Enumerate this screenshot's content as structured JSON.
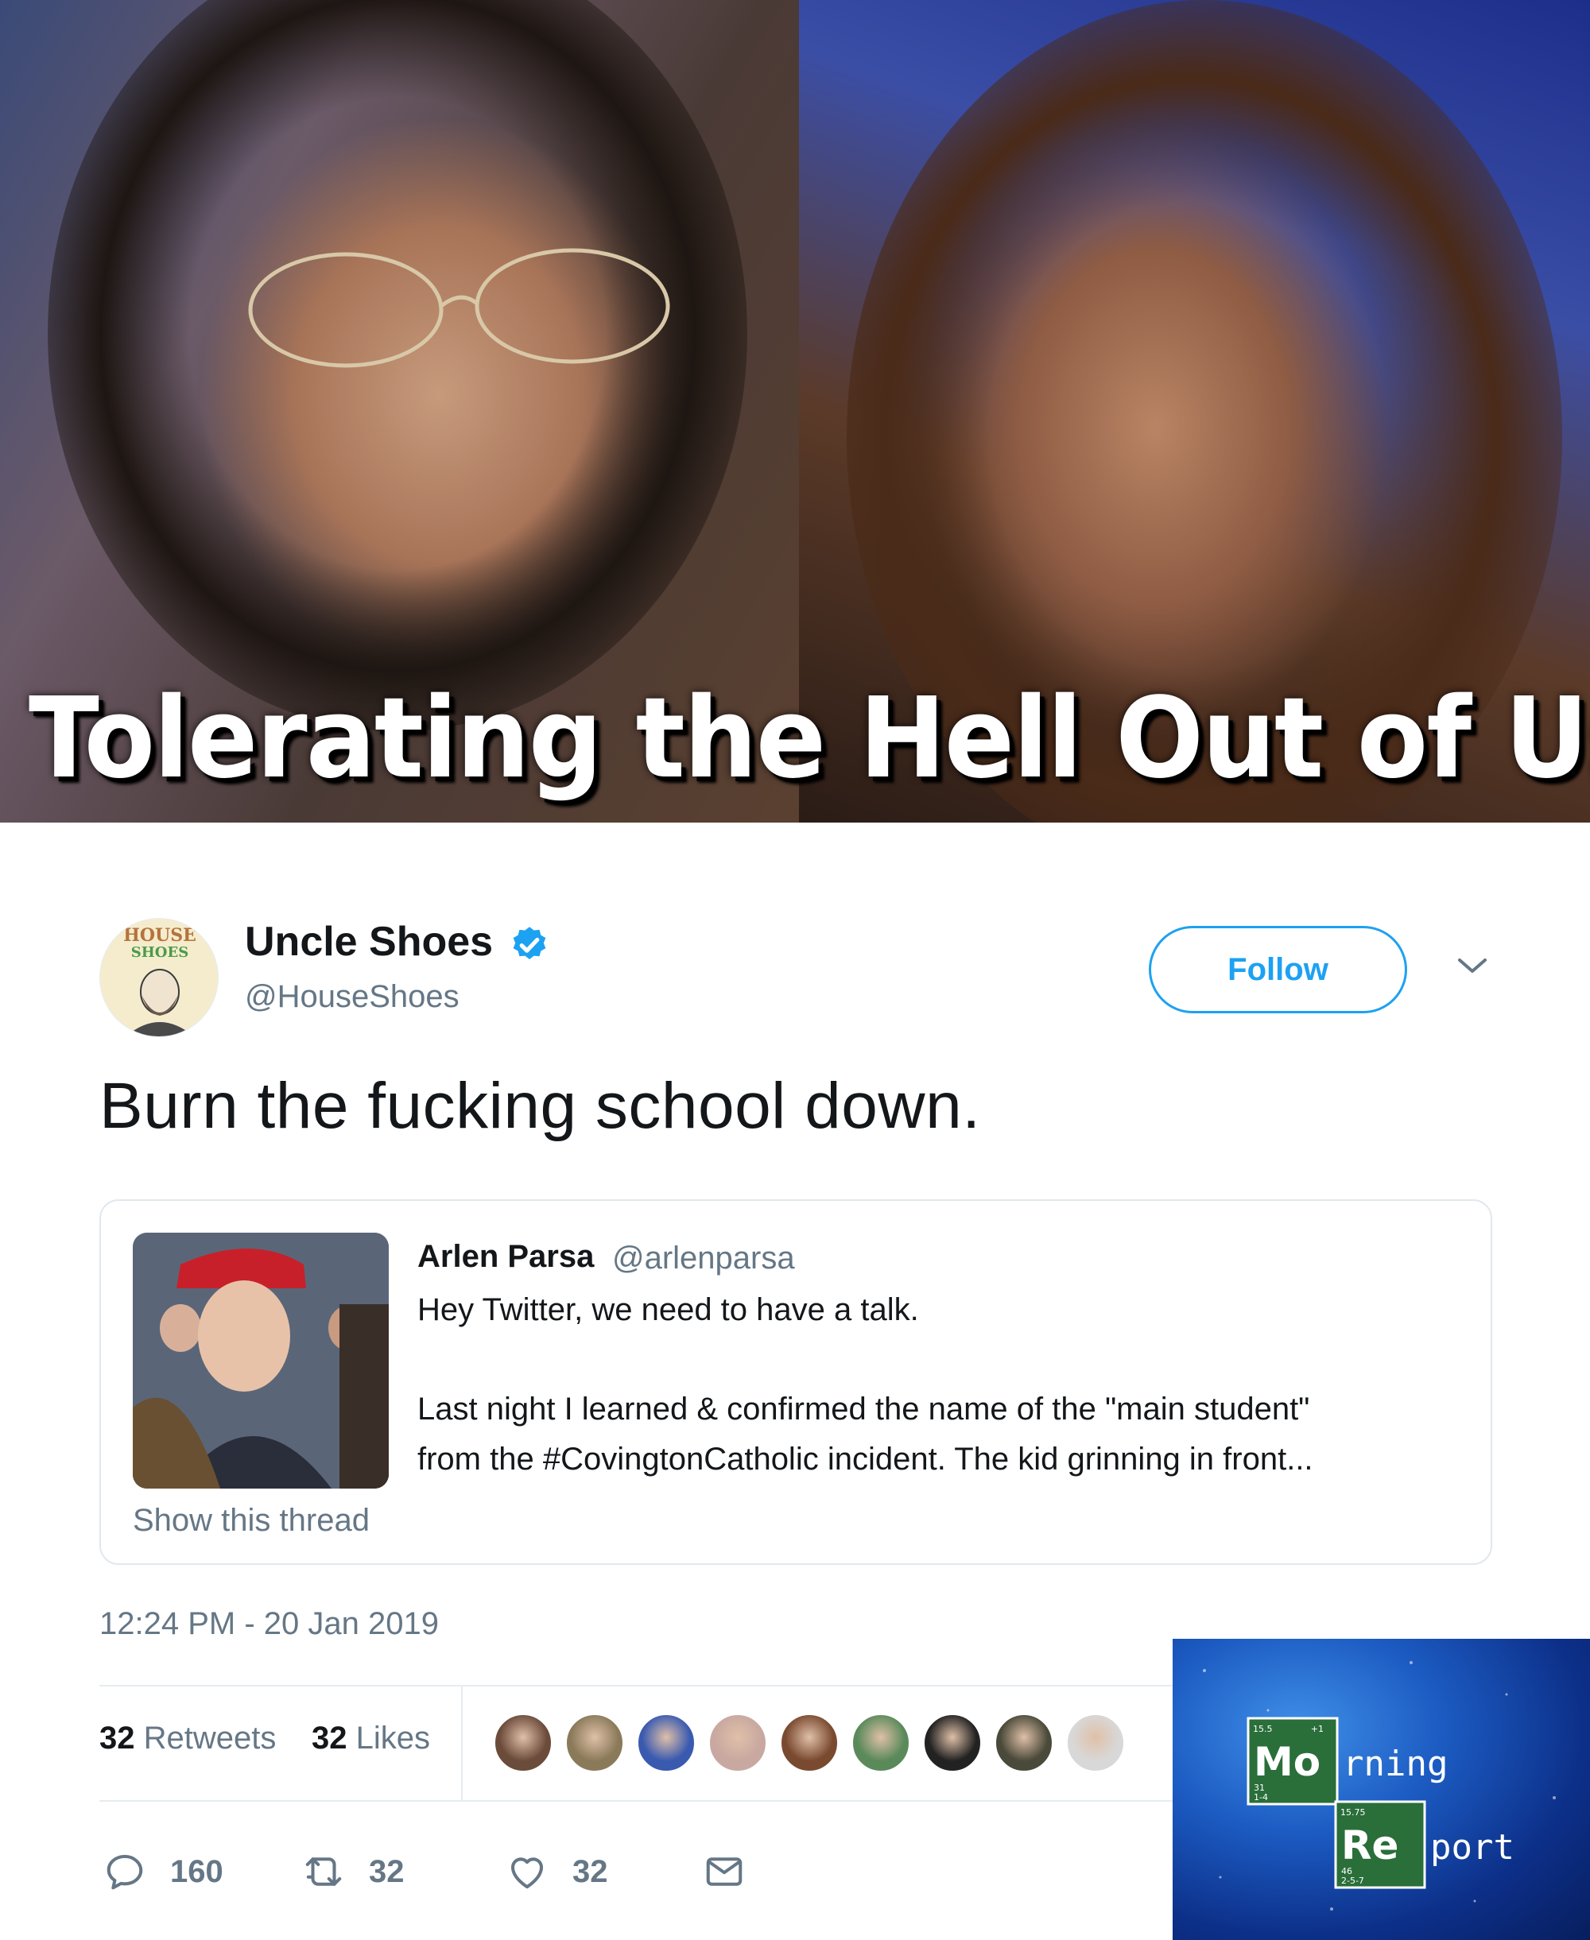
{
  "banner": {
    "headline": "Tolerating the Hell Out of Us"
  },
  "tweet": {
    "author": {
      "display_name": "Uncle Shoes",
      "handle": "@HouseShoes",
      "avatar_text_top": "HOUSE",
      "avatar_text_bottom": "SHOES",
      "verified": true
    },
    "follow_label": "Follow",
    "text": "Burn the fucking school down.",
    "quote": {
      "author": "Arlen Parsa",
      "handle": "@arlenparsa",
      "line1": "Hey Twitter, we need to have a talk.",
      "line2": "Last night I learned & confirmed the name of the \"main student\"",
      "line3": "from the #CovingtonCatholic incident. The kid grinning in front...",
      "show_thread": "Show this thread"
    },
    "timestamp": "12:24 PM - 20 Jan 2019",
    "stats": {
      "retweets_count": "32",
      "retweets_label": "Retweets",
      "likes_count": "32",
      "likes_label": "Likes"
    },
    "liker_colors": [
      "#6b4b3a",
      "#8a7a5a",
      "#3a5ab0",
      "#c8a8a0",
      "#7a4a30",
      "#5a8a5a",
      "#222222",
      "#4a4a3a",
      "#d8d8d8"
    ],
    "actions": {
      "reply_count": "160",
      "retweet_count": "32",
      "like_count": "32"
    }
  },
  "logo": {
    "word1_symbol": "Mo",
    "word1_rest": "rning",
    "word2_symbol": "Re",
    "word2_rest": "port",
    "mo_top_left": "15.5",
    "mo_top_right": "+1",
    "mo_bottom_1": "31",
    "mo_bottom_2": "1-4",
    "re_top_left": "15.75",
    "re_bottom_1": "46",
    "re_bottom_2": "2-5-7"
  },
  "accent_color": "#1da1f2"
}
